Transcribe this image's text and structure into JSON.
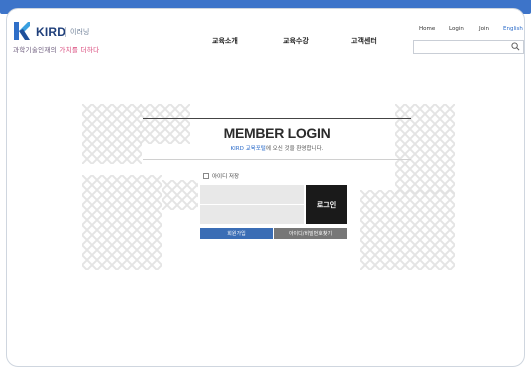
{
  "header": {
    "logo_text": "KIRD",
    "logo_sub": "이러닝",
    "slogan_prefix": "과학기술인재의 ",
    "slogan_highlight": "가치를 더하다",
    "nav": [
      "교육소개",
      "교육수강",
      "고객센터"
    ],
    "util": {
      "home": "Home",
      "login": "Login",
      "join": "Join",
      "english": "English"
    },
    "search_placeholder": ""
  },
  "login": {
    "title": "MEMBER LOGIN",
    "subtitle_brand": "KIRD 교육포털",
    "subtitle_rest": "에 오신 것을 환영합니다.",
    "remember_label": "아이디 저장",
    "id_placeholder": "",
    "pw_placeholder": "",
    "login_button": "로그인",
    "signup_button": "회원가입",
    "find_button": "아이디/비밀번호찾기"
  },
  "colors": {
    "accent": "#3d74c9",
    "brand": "#1f3f7a",
    "highlight": "#d9477a"
  }
}
